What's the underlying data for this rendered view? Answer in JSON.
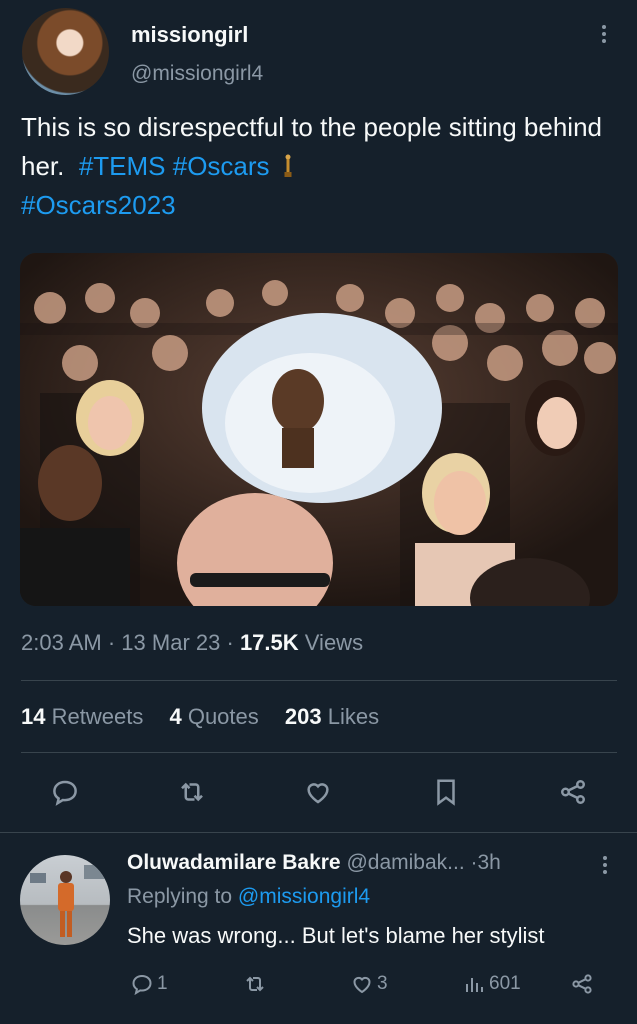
{
  "tweet": {
    "author_name": "missiongirl",
    "author_handle": "@missiongirl4",
    "text_plain": "This is so disrespectful to the people sitting behind her.",
    "hashtags": [
      "#TEMS",
      "#Oscars",
      "#Oscars2023"
    ],
    "time": "2:03 AM",
    "date": "13 Mar 23",
    "views_count": "17.5K",
    "views_label": "Views",
    "sep": "·"
  },
  "stats": {
    "retweets_count": "14",
    "retweets_label": "Retweets",
    "quotes_count": "4",
    "quotes_label": "Quotes",
    "likes_count": "203",
    "likes_label": "Likes"
  },
  "actions": {
    "icons": [
      "reply-icon",
      "retweet-icon",
      "like-icon",
      "bookmark-icon",
      "share-icon"
    ]
  },
  "reply": {
    "author_name": "Oluwadamilare Bakre",
    "author_handle": "@damibak...",
    "time": "3h",
    "sep": "·",
    "replying_prefix": "Replying to",
    "replying_to": "@missiongirl4",
    "text": "She was wrong... But let's blame her stylist",
    "reply_count": "1",
    "like_count": "3",
    "views_count": "601"
  },
  "colors": {
    "background": "#15202b",
    "accent": "#1d9bf0",
    "secondary_text": "#8b98a5",
    "divider": "#38444d"
  }
}
